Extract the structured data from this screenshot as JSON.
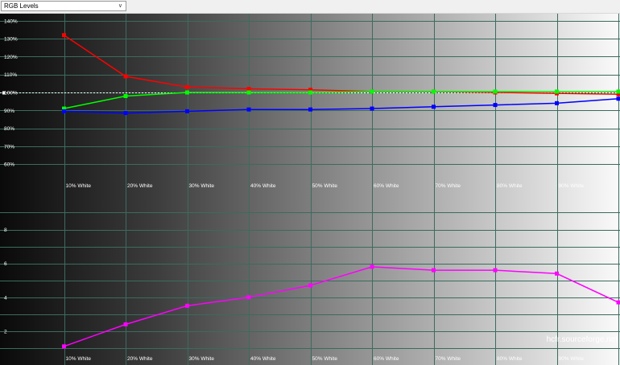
{
  "toolbar": {
    "view_select": "RGB Levels"
  },
  "watermark": "hcfr.sourceforge.net",
  "chart_data": [
    {
      "type": "line",
      "categories": [
        "",
        "10% White",
        "20% White",
        "30% White",
        "40% White",
        "50% White",
        "60% White",
        "70% White",
        "80% White",
        "90% White",
        ""
      ],
      "y_tick_labels": [
        "140%",
        "130%",
        "120%",
        "110%",
        "100%",
        "90%",
        "80%",
        "70%",
        "60%"
      ],
      "y_ticks": [
        140,
        130,
        120,
        110,
        100,
        90,
        80,
        70,
        60
      ],
      "ylim": [
        56,
        144
      ],
      "reference": 100,
      "grid": true,
      "series": [
        {
          "color": "#ff0000",
          "values": [
            null,
            132,
            109,
            103,
            102,
            101.5,
            100.5,
            100.5,
            100,
            99.5,
            99
          ]
        },
        {
          "color": "#00ff00",
          "values": [
            null,
            91,
            98,
            100,
            100,
            100,
            100.5,
            100.5,
            100.5,
            100.5,
            100.5
          ]
        },
        {
          "color": "#0000ff",
          "values": [
            null,
            89.5,
            88.5,
            89.5,
            90.5,
            90.5,
            91,
            92,
            93,
            94,
            96.5
          ]
        }
      ]
    },
    {
      "type": "line",
      "categories": [
        "",
        "10% White",
        "20% White",
        "30% White",
        "40% White",
        "50% White",
        "60% White",
        "70% White",
        "80% White",
        "90% White",
        ""
      ],
      "y_tick_labels": [
        "8",
        "6",
        "4",
        "2"
      ],
      "y_ticks": [
        8,
        6,
        4,
        2
      ],
      "ylim": [
        0,
        10.4
      ],
      "grid": true,
      "series": [
        {
          "color": "#ff00ff",
          "values": [
            null,
            1.1,
            2.4,
            3.5,
            4.0,
            4.7,
            5.8,
            5.6,
            5.6,
            5.4,
            3.7
          ]
        }
      ]
    }
  ]
}
